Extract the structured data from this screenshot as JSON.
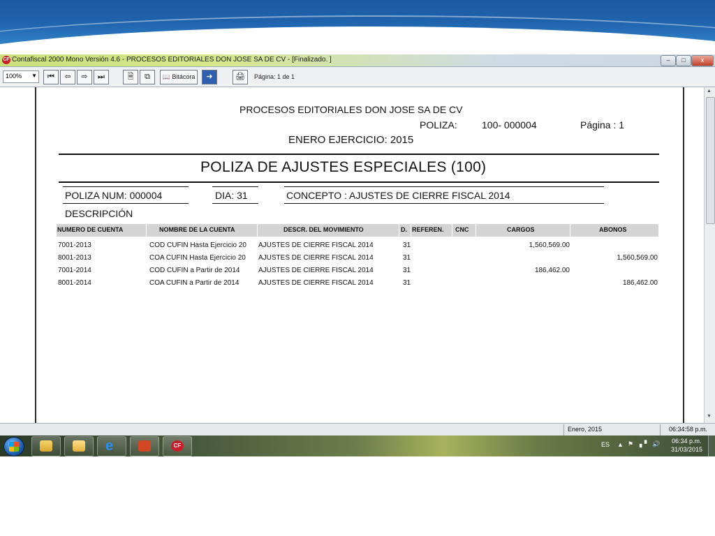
{
  "window": {
    "title": "Contafiscal 2000 Mono Versión 4.6 - PROCESOS EDITORIALES DON JOSE SA DE CV - [Finalizado. ]",
    "app_icon": "CF",
    "minimize": "–",
    "maximize": "□",
    "close": "x"
  },
  "toolbar": {
    "zoom": "100%",
    "bitacora_label": "Bitácora",
    "page_label": "Página:",
    "page_value": "1 de 1"
  },
  "report": {
    "company": "PROCESOS EDITORIALES DON JOSE SA DE CV",
    "poliza_label": "POLIZA:",
    "poliza_value": "100- 000004",
    "pagina": "Página : 1",
    "ejercicio": "ENERO EJERCICIO: 2015",
    "title": "POLIZA DE AJUSTES ESPECIALES (100)",
    "poliza_num": "POLIZA NUM: 000004",
    "dia": "DIA: 31",
    "concepto": "CONCEPTO : AJUSTES DE CIERRE FISCAL 2014",
    "descripcion": "DESCRIPCIÓN",
    "columns": [
      "NUMERO DE CUENTA",
      "NOMBRE DE LA CUENTA",
      "DESCR. DEL MOVIMIENTO",
      "D.",
      "REFEREN.",
      "CNC",
      "CARGOS",
      "ABONOS"
    ],
    "rows": [
      {
        "cuenta": "7001-2013",
        "nombre": "COD CUFIN Hasta Ejercicio 20",
        "movimiento": "AJUSTES DE CIERRE FISCAL 2014",
        "dia": "31",
        "cargos": "1,560,569.00",
        "abonos": ""
      },
      {
        "cuenta": "8001-2013",
        "nombre": "COA CUFIN Hasta Ejercicio 20",
        "movimiento": "AJUSTES DE CIERRE FISCAL 2014",
        "dia": "31",
        "cargos": "",
        "abonos": "1,560,569.00"
      },
      {
        "cuenta": "7001-2014",
        "nombre": "COD CUFIN a Partir de 2014",
        "movimiento": "AJUSTES DE CIERRE FISCAL 2014",
        "dia": "31",
        "cargos": "186,462.00",
        "abonos": ""
      },
      {
        "cuenta": "8001-2014",
        "nombre": "COA CUFIN a Partir de 2014",
        "movimiento": "AJUSTES DE CIERRE FISCAL 2014",
        "dia": "31",
        "cargos": "",
        "abonos": "186,462.00"
      }
    ]
  },
  "status": {
    "period": "Enero, 2015",
    "time": "06:34:58 p.m."
  },
  "taskbar": {
    "items": [
      "explorer-icon",
      "folder-icon",
      "ie-icon",
      "powerpoint-icon",
      "contafiscal-icon"
    ],
    "language": "ES",
    "clock_time": "06:34 p.m.",
    "clock_date": "31/03/2015"
  }
}
